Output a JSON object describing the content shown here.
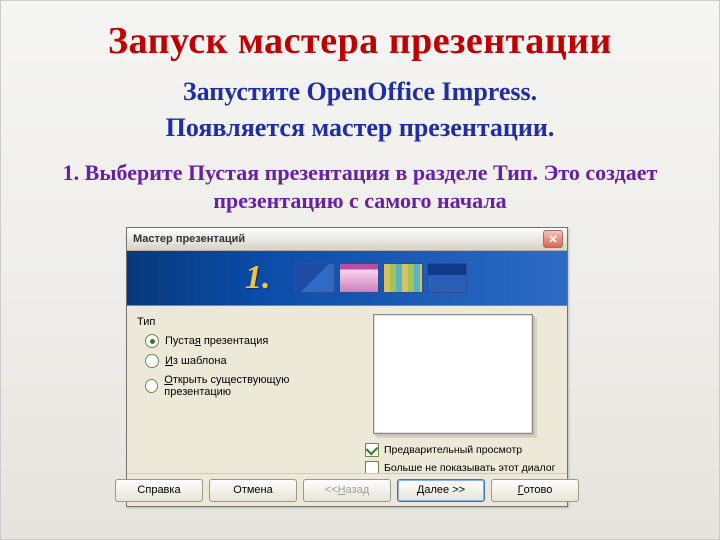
{
  "slide": {
    "title": "Запуск мастера презентации",
    "line1": "Запустите OpenOffice Impress.",
    "line2": "Появляется мастер презентации.",
    "step1": "1. Выберите Пустая презентация в разделе Тип. Это создает презентацию с самого начала"
  },
  "dialog": {
    "title": "Мастер презентаций",
    "step_number": "1.",
    "group_label": "Тип",
    "radios": {
      "r1_pre": "Пуста",
      "r1_u": "я",
      "r1_post": " презентация",
      "r2_pre": "",
      "r2_u": "И",
      "r2_post": "з шаблона",
      "r3_pre": "",
      "r3_u": "О",
      "r3_post": "ткрыть существующую презентацию"
    },
    "checks": {
      "c1_pre": "Предварительный прос",
      "c1_u": "м",
      "c1_post": "отр",
      "c2_pre": "",
      "c2_u": "Б",
      "c2_post": "ольше не показывать этот диалог"
    },
    "buttons": {
      "help": "Справка",
      "cancel": "Отмена",
      "back_pre": "<< ",
      "back_u": "Н",
      "back_post": "азад",
      "next_pre": "",
      "next_u": "Д",
      "next_post": "алее >>",
      "finish_pre": "",
      "finish_u": "Г",
      "finish_post": "отово"
    }
  }
}
